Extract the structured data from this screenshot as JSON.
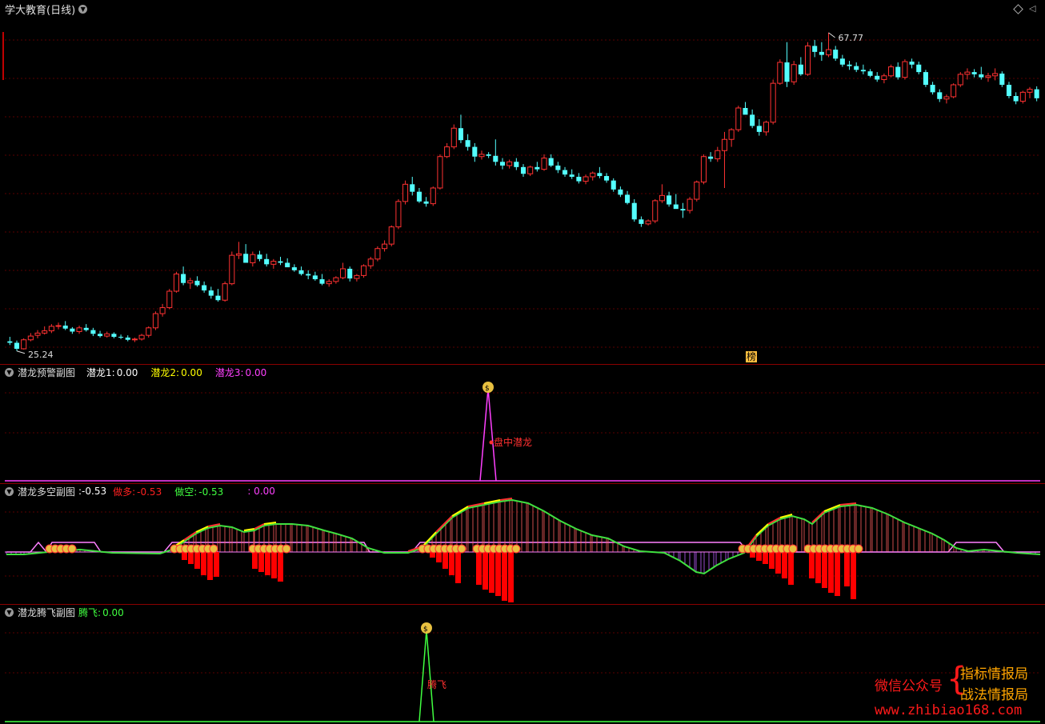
{
  "main": {
    "title": "学大教育(日线)",
    "high_label": "67.77",
    "low_label": "25.24",
    "badge": "榜",
    "colors": {
      "up": "#ff3232",
      "down": "#54ffff",
      "grid": "#5a0000",
      "border": "#8b0000"
    }
  },
  "chart_data": [
    {
      "type": "candlestick",
      "title": "学大教育(日线)",
      "annotations": [
        "67.77",
        "25.24"
      ],
      "ohlc_note": "approximate daily candles, rising up",
      "candles": [
        [
          26.5,
          27.1,
          26.0,
          26.3
        ],
        [
          26.3,
          26.6,
          25.2,
          25.5
        ],
        [
          25.5,
          26.9,
          25.4,
          26.7
        ],
        [
          26.7,
          27.6,
          26.5,
          27.2
        ],
        [
          27.3,
          28.0,
          26.9,
          27.6
        ],
        [
          27.6,
          28.5,
          27.4,
          27.9
        ],
        [
          27.9,
          28.8,
          27.6,
          28.5
        ],
        [
          28.5,
          29.0,
          28.1,
          28.6
        ],
        [
          28.6,
          29.2,
          28.0,
          28.2
        ],
        [
          28.2,
          28.4,
          27.5,
          27.8
        ],
        [
          27.8,
          28.6,
          27.5,
          28.3
        ],
        [
          28.3,
          28.8,
          27.8,
          28.0
        ],
        [
          28.0,
          28.3,
          27.2,
          27.5
        ],
        [
          27.5,
          27.9,
          27.0,
          27.2
        ],
        [
          27.2,
          27.8,
          27.0,
          27.5
        ],
        [
          27.5,
          27.7,
          26.9,
          27.1
        ],
        [
          27.1,
          27.4,
          26.8,
          27.0
        ],
        [
          27.0,
          27.3,
          26.5,
          26.7
        ],
        [
          26.7,
          27.0,
          26.4,
          26.8
        ],
        [
          26.8,
          27.5,
          26.6,
          27.3
        ],
        [
          27.3,
          28.5,
          27.0,
          28.3
        ],
        [
          28.3,
          30.5,
          28.0,
          30.2
        ],
        [
          30.2,
          31.5,
          29.8,
          31.0
        ],
        [
          31.0,
          33.5,
          30.8,
          33.2
        ],
        [
          33.2,
          35.8,
          33.0,
          35.5
        ],
        [
          35.5,
          36.5,
          34.0,
          34.3
        ],
        [
          34.3,
          35.0,
          33.5,
          34.6
        ],
        [
          34.6,
          35.2,
          33.8,
          34.0
        ],
        [
          34.0,
          34.5,
          33.0,
          33.3
        ],
        [
          33.3,
          33.8,
          32.2,
          32.6
        ],
        [
          32.6,
          33.5,
          31.8,
          32.0
        ],
        [
          32.0,
          34.5,
          31.8,
          34.2
        ],
        [
          34.2,
          38.5,
          34.0,
          38.0
        ],
        [
          38.0,
          39.8,
          37.5,
          38.2
        ],
        [
          38.2,
          39.5,
          37.5,
          37.0
        ],
        [
          37.0,
          38.5,
          36.5,
          38.1
        ],
        [
          38.1,
          38.6,
          37.2,
          37.5
        ],
        [
          37.5,
          38.2,
          36.5,
          36.8
        ],
        [
          36.8,
          37.5,
          36.2,
          37.2
        ],
        [
          37.2,
          37.8,
          36.7,
          37.0
        ],
        [
          37.0,
          37.6,
          36.5,
          36.4
        ],
        [
          36.4,
          36.8,
          35.8,
          36.0
        ],
        [
          36.0,
          36.5,
          35.3,
          35.5
        ],
        [
          35.5,
          36.0,
          34.8,
          35.3
        ],
        [
          35.3,
          35.8,
          34.6,
          34.8
        ],
        [
          34.8,
          35.5,
          34.0,
          34.2
        ],
        [
          34.2,
          34.8,
          33.8,
          34.5
        ],
        [
          34.5,
          35.2,
          34.2,
          35.0
        ],
        [
          35.0,
          37.0,
          34.8,
          36.2
        ],
        [
          36.2,
          36.5,
          34.5,
          34.9
        ],
        [
          34.9,
          35.5,
          34.5,
          35.3
        ],
        [
          35.3,
          36.8,
          35.0,
          36.6
        ],
        [
          36.6,
          37.8,
          36.2,
          37.5
        ],
        [
          37.5,
          39.2,
          37.2,
          38.9
        ],
        [
          38.9,
          40.0,
          38.5,
          39.5
        ],
        [
          39.5,
          42.0,
          39.2,
          41.8
        ],
        [
          41.8,
          45.5,
          41.5,
          45.2
        ],
        [
          45.2,
          48.0,
          44.8,
          47.5
        ],
        [
          47.5,
          48.5,
          46.0,
          46.5
        ],
        [
          46.5,
          47.0,
          45.0,
          45.2
        ],
        [
          45.2,
          45.8,
          44.5,
          44.9
        ],
        [
          44.9,
          47.2,
          44.6,
          47.0
        ],
        [
          47.0,
          51.5,
          46.8,
          51.2
        ],
        [
          51.2,
          53.0,
          51.0,
          52.5
        ],
        [
          52.5,
          55.5,
          52.2,
          55.0
        ],
        [
          55.0,
          56.8,
          53.0,
          53.4
        ],
        [
          53.4,
          54.2,
          52.0,
          52.5
        ],
        [
          52.5,
          53.0,
          50.5,
          51.2
        ],
        [
          51.2,
          52.0,
          50.8,
          51.5
        ],
        [
          51.5,
          51.8,
          51.0,
          51.3
        ],
        [
          51.3,
          53.5,
          50.0,
          50.5
        ],
        [
          50.5,
          51.0,
          49.5,
          50.0
        ],
        [
          50.0,
          50.8,
          49.6,
          50.5
        ],
        [
          50.5,
          51.0,
          49.4,
          49.8
        ],
        [
          49.8,
          50.2,
          48.5,
          48.9
        ],
        [
          48.9,
          50.0,
          48.6,
          49.8
        ],
        [
          49.8,
          50.5,
          49.2,
          49.5
        ],
        [
          49.5,
          51.5,
          49.3,
          51.0
        ],
        [
          51.0,
          51.5,
          49.8,
          50.0
        ],
        [
          50.0,
          50.5,
          49.0,
          49.4
        ],
        [
          49.4,
          49.8,
          48.5,
          48.8
        ],
        [
          48.8,
          49.5,
          48.2,
          48.5
        ],
        [
          48.5,
          49.0,
          47.6,
          47.9
        ],
        [
          47.9,
          48.8,
          47.5,
          48.5
        ],
        [
          48.5,
          49.2,
          48.0,
          49.0
        ],
        [
          49.0,
          49.8,
          48.3,
          48.6
        ],
        [
          48.6,
          49.0,
          47.7,
          48.0
        ],
        [
          48.0,
          48.3,
          46.5,
          46.8
        ],
        [
          46.8,
          47.2,
          45.8,
          46.1
        ],
        [
          46.1,
          46.6,
          44.8,
          45.0
        ],
        [
          45.0,
          45.5,
          42.5,
          42.8
        ],
        [
          42.8,
          43.2,
          41.8,
          42.2
        ],
        [
          42.2,
          42.8,
          42.0,
          42.6
        ],
        [
          42.6,
          45.5,
          42.3,
          45.3
        ],
        [
          45.3,
          47.5,
          45.0,
          46.0
        ],
        [
          46.0,
          46.5,
          44.5,
          44.8
        ],
        [
          44.8,
          46.2,
          44.5,
          44.2
        ],
        [
          44.2,
          45.0,
          43.0,
          44.0
        ],
        [
          44.0,
          45.8,
          43.6,
          45.5
        ],
        [
          45.5,
          48.0,
          45.2,
          47.8
        ],
        [
          47.8,
          51.5,
          47.5,
          51.2
        ],
        [
          51.2,
          51.8,
          50.5,
          50.9
        ],
        [
          50.9,
          52.5,
          50.5,
          52.0
        ],
        [
          52.0,
          54.5,
          47.0,
          53.5
        ],
        [
          53.5,
          55.0,
          52.5,
          54.8
        ],
        [
          54.8,
          58.0,
          54.5,
          57.7
        ],
        [
          57.7,
          58.5,
          57.0,
          56.8
        ],
        [
          56.8,
          57.5,
          55.0,
          55.3
        ],
        [
          55.3,
          56.2,
          54.0,
          54.5
        ],
        [
          54.5,
          56.0,
          54.0,
          55.8
        ],
        [
          55.8,
          61.5,
          55.5,
          61.0
        ],
        [
          61.0,
          64.2,
          60.8,
          63.8
        ],
        [
          63.8,
          66.5,
          60.5,
          61.2
        ],
        [
          61.2,
          64.0,
          60.8,
          63.5
        ],
        [
          63.5,
          64.5,
          62.0,
          62.2
        ],
        [
          62.2,
          66.5,
          62.0,
          66.0
        ],
        [
          66.0,
          66.8,
          64.5,
          65.2
        ],
        [
          65.2,
          66.5,
          64.0,
          64.8
        ],
        [
          64.8,
          67.77,
          64.5,
          65.5
        ],
        [
          65.5,
          66.0,
          64.0,
          64.3
        ],
        [
          64.3,
          64.8,
          63.2,
          63.5
        ],
        [
          63.5,
          64.0,
          62.8,
          63.3
        ],
        [
          63.3,
          63.8,
          62.5,
          62.8
        ],
        [
          62.8,
          63.5,
          62.2,
          62.6
        ],
        [
          62.6,
          62.9,
          61.8,
          62.0
        ],
        [
          62.0,
          62.5,
          61.2,
          61.5
        ],
        [
          61.5,
          62.3,
          61.0,
          62.0
        ],
        [
          62.0,
          63.5,
          61.8,
          63.2
        ],
        [
          63.2,
          63.8,
          61.5,
          61.8
        ],
        [
          61.8,
          64.2,
          61.5,
          63.9
        ],
        [
          63.9,
          64.3,
          63.0,
          63.5
        ],
        [
          63.5,
          63.9,
          62.2,
          62.5
        ],
        [
          62.5,
          62.8,
          60.5,
          60.8
        ],
        [
          60.8,
          61.2,
          59.5,
          59.8
        ],
        [
          59.8,
          60.2,
          58.5,
          58.9
        ],
        [
          58.9,
          59.5,
          58.3,
          59.2
        ],
        [
          59.2,
          61.0,
          59.0,
          60.8
        ],
        [
          60.8,
          62.5,
          60.5,
          62.2
        ],
        [
          62.2,
          63.0,
          61.5,
          62.5
        ],
        [
          62.5,
          62.9,
          61.8,
          62.2
        ],
        [
          62.2,
          63.2,
          61.5,
          61.8
        ],
        [
          61.8,
          62.4,
          61.2,
          62.0
        ],
        [
          62.0,
          63.0,
          61.4,
          62.3
        ],
        [
          62.3,
          62.6,
          60.5,
          60.8
        ],
        [
          60.8,
          61.2,
          59.0,
          59.3
        ],
        [
          59.3,
          59.8,
          58.2,
          58.6
        ],
        [
          58.6,
          60.0,
          58.3,
          59.8
        ],
        [
          59.8,
          60.5,
          59.0,
          60.2
        ],
        [
          60.2,
          60.6,
          58.6,
          59.0
        ]
      ],
      "ylim": [
        24,
        70
      ]
    },
    {
      "type": "line",
      "title": "潜龙预警副图",
      "series": [
        {
          "name": "潜龙1",
          "color": "#ffffff",
          "values": [
            0
          ]
        },
        {
          "name": "潜龙2",
          "color": "#ffff00",
          "values": [
            0
          ]
        },
        {
          "name": "潜龙3",
          "color": "#ff40ff",
          "values": [
            0
          ]
        }
      ],
      "annotations": [
        "盘中潜龙"
      ]
    },
    {
      "type": "line",
      "title": "潜龙多空副图",
      "series": [
        {
          "name": "做多",
          "color": "#ff2020",
          "values": [
            -0.53
          ]
        },
        {
          "name": "做空",
          "color": "#40ff40",
          "values": [
            -0.53
          ]
        }
      ]
    },
    {
      "type": "line",
      "title": "潜龙腾飞副图",
      "series": [
        {
          "name": "腾飞",
          "color": "#40ff40",
          "values": [
            0
          ]
        }
      ],
      "annotations": [
        "腾飞"
      ]
    }
  ],
  "sub1": {
    "title": "潜龙预警副图",
    "s1_label": "潜龙1:",
    "s1_value": "0.00",
    "s2_label": "潜龙2:",
    "s2_value": "0.00",
    "s3_label": "潜龙3:",
    "s3_value": "0.00",
    "annotation": "盘中潜龙"
  },
  "sub2": {
    "title": "潜龙多空副图",
    "main_value": ":-0.53",
    "long_label": "做多:",
    "long_value": "-0.53",
    "short_label": "做空:",
    "short_value": "-0.53",
    "extra_value": ": 0.00"
  },
  "sub3": {
    "title": "潜龙腾飞副图",
    "s1_label": "腾飞:",
    "s1_value": "0.00",
    "annotation": "腾飞"
  },
  "watermark": {
    "wechat": "微信公众号",
    "name1": "指标情报局",
    "name2": "战法情报局",
    "url": "www.zhibiao168.com"
  }
}
